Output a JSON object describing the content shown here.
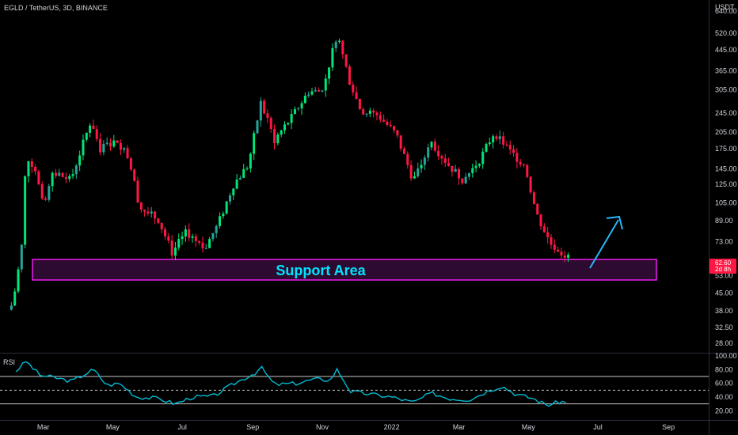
{
  "header": {
    "title": "EGLD / TetherUS, 3D, BINANCE"
  },
  "chart_data": [
    {
      "type": "candlestick",
      "title": "EGLD / TetherUS, 3D, BINANCE",
      "y_unit": "USDT",
      "y_scale": "log",
      "ylim": [
        26,
        700
      ],
      "y_ticks": [
        "640.00",
        "520.00",
        "445.00",
        "365.00",
        "305.00",
        "245.00",
        "205.00",
        "175.00",
        "145.00",
        "125.00",
        "105.00",
        "89.00",
        "73.00",
        "53.00",
        "45.00",
        "38.00",
        "32.50",
        "28.00"
      ],
      "x_ticks": [
        "Mar",
        "May",
        "Jul",
        "Sep",
        "Nov",
        "2022",
        "Mar",
        "May",
        "Jul",
        "Sep"
      ],
      "approx_close_path": [
        {
          "date": "2021-02-01",
          "close": 40
        },
        {
          "date": "2021-02-05",
          "close": 48
        },
        {
          "date": "2021-02-10",
          "close": 70
        },
        {
          "date": "2021-02-14",
          "close": 165
        },
        {
          "date": "2021-02-22",
          "close": 145
        },
        {
          "date": "2021-03-01",
          "close": 100
        },
        {
          "date": "2021-03-10",
          "close": 140
        },
        {
          "date": "2021-03-25",
          "close": 130
        },
        {
          "date": "2021-04-12",
          "close": 230
        },
        {
          "date": "2021-04-20",
          "close": 175
        },
        {
          "date": "2021-05-05",
          "close": 190
        },
        {
          "date": "2021-05-15",
          "close": 160
        },
        {
          "date": "2021-05-25",
          "close": 100
        },
        {
          "date": "2021-06-10",
          "close": 90
        },
        {
          "date": "2021-06-22",
          "close": 66
        },
        {
          "date": "2021-07-05",
          "close": 80
        },
        {
          "date": "2021-07-20",
          "close": 68
        },
        {
          "date": "2021-08-01",
          "close": 85
        },
        {
          "date": "2021-08-15",
          "close": 125
        },
        {
          "date": "2021-08-28",
          "close": 150
        },
        {
          "date": "2021-09-08",
          "close": 270
        },
        {
          "date": "2021-09-20",
          "close": 190
        },
        {
          "date": "2021-10-05",
          "close": 235
        },
        {
          "date": "2021-10-20",
          "close": 300
        },
        {
          "date": "2021-11-01",
          "close": 300
        },
        {
          "date": "2021-11-14",
          "close": 520
        },
        {
          "date": "2021-11-25",
          "close": 330
        },
        {
          "date": "2021-12-05",
          "close": 250
        },
        {
          "date": "2021-12-20",
          "close": 240
        },
        {
          "date": "2022-01-05",
          "close": 200
        },
        {
          "date": "2022-01-20",
          "close": 130
        },
        {
          "date": "2022-02-05",
          "close": 185
        },
        {
          "date": "2022-02-20",
          "close": 150
        },
        {
          "date": "2022-03-05",
          "close": 130
        },
        {
          "date": "2022-03-20",
          "close": 160
        },
        {
          "date": "2022-04-01",
          "close": 205
        },
        {
          "date": "2022-04-15",
          "close": 170
        },
        {
          "date": "2022-04-28",
          "close": 150
        },
        {
          "date": "2022-05-08",
          "close": 95
        },
        {
          "date": "2022-05-20",
          "close": 72
        },
        {
          "date": "2022-06-05",
          "close": 62.6
        }
      ],
      "current_price": "62.60",
      "countdown": "2d 8h",
      "annotations": {
        "support_label": "Support Area",
        "support_range": [
          54,
          66
        ]
      },
      "colors": {
        "up": "#26a69a",
        "up_bright": "#00e676",
        "down": "#ff1744",
        "support_border": "#e91ee9",
        "support_fill": "#2d0a30",
        "arrow": "#29b6f6",
        "price_tag": "#ff1744"
      }
    },
    {
      "type": "line",
      "title": "RSI",
      "ylim": [
        10,
        100
      ],
      "y_ticks": [
        "100.00",
        "80.00",
        "60.00",
        "40.00",
        "20.00"
      ],
      "bands": [
        70,
        50,
        30
      ],
      "approx_values": [
        {
          "date": "2021-02-05",
          "rsi": 78
        },
        {
          "date": "2021-02-14",
          "rsi": 92
        },
        {
          "date": "2021-02-26",
          "rsi": 72
        },
        {
          "date": "2021-03-12",
          "rsi": 68
        },
        {
          "date": "2021-03-26",
          "rsi": 63
        },
        {
          "date": "2021-04-14",
          "rsi": 80
        },
        {
          "date": "2021-04-26",
          "rsi": 57
        },
        {
          "date": "2021-05-07",
          "rsi": 60
        },
        {
          "date": "2021-05-22",
          "rsi": 40
        },
        {
          "date": "2021-06-10",
          "rsi": 38
        },
        {
          "date": "2021-06-25",
          "rsi": 30
        },
        {
          "date": "2021-07-10",
          "rsi": 40
        },
        {
          "date": "2021-07-28",
          "rsi": 41
        },
        {
          "date": "2021-08-16",
          "rsi": 60
        },
        {
          "date": "2021-09-04",
          "rsi": 76
        },
        {
          "date": "2021-09-08",
          "rsi": 84
        },
        {
          "date": "2021-09-20",
          "rsi": 58
        },
        {
          "date": "2021-10-10",
          "rsi": 60
        },
        {
          "date": "2021-10-25",
          "rsi": 66
        },
        {
          "date": "2021-11-08",
          "rsi": 65
        },
        {
          "date": "2021-11-14",
          "rsi": 80
        },
        {
          "date": "2021-11-26",
          "rsi": 48
        },
        {
          "date": "2021-12-10",
          "rsi": 45
        },
        {
          "date": "2022-01-01",
          "rsi": 40
        },
        {
          "date": "2022-01-20",
          "rsi": 32
        },
        {
          "date": "2022-02-05",
          "rsi": 46
        },
        {
          "date": "2022-02-20",
          "rsi": 38
        },
        {
          "date": "2022-03-10",
          "rsi": 36
        },
        {
          "date": "2022-03-28",
          "rsi": 50
        },
        {
          "date": "2022-04-08",
          "rsi": 56
        },
        {
          "date": "2022-04-20",
          "rsi": 44
        },
        {
          "date": "2022-05-05",
          "rsi": 38
        },
        {
          "date": "2022-05-18",
          "rsi": 28
        },
        {
          "date": "2022-05-30",
          "rsi": 34
        },
        {
          "date": "2022-06-05",
          "rsi": 30
        }
      ],
      "colors": {
        "line": "#00bcd4",
        "band": "#c8c8c8"
      }
    }
  ]
}
